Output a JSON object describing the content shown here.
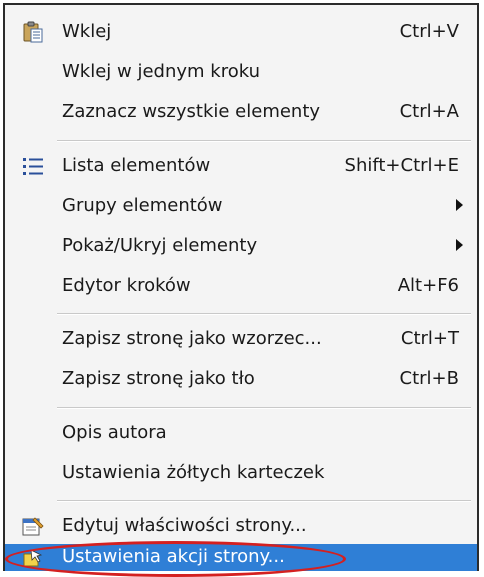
{
  "menu": {
    "items": [
      {
        "label": "Wklej",
        "shortcut": "Ctrl+V",
        "icon": "paste-icon"
      },
      {
        "label": "Wklej w jednym kroku",
        "shortcut": ""
      },
      {
        "label": "Zaznacz wszystkie elementy",
        "shortcut": "Ctrl+A"
      },
      {
        "label": "Lista elementów",
        "shortcut": "Shift+Ctrl+E",
        "icon": "list-icon"
      },
      {
        "label": "Grupy elementów",
        "submenu": true
      },
      {
        "label": "Pokaż/Ukryj elementy",
        "submenu": true
      },
      {
        "label": "Edytor kroków",
        "shortcut": "Alt+F6"
      },
      {
        "label": "Zapisz stronę jako wzorzec...",
        "shortcut": "Ctrl+T"
      },
      {
        "label": "Zapisz stronę jako tło",
        "shortcut": "Ctrl+B"
      },
      {
        "label": "Opis autora",
        "shortcut": ""
      },
      {
        "label": "Ustawienia żółtych karteczek",
        "shortcut": ""
      },
      {
        "label": "Edytuj właściwości strony...",
        "shortcut": "",
        "icon": "page-properties-icon"
      },
      {
        "label": "Ustawienia akcji strony...",
        "shortcut": "",
        "icon": "page-actions-icon",
        "highlighted": true
      }
    ]
  },
  "colors": {
    "highlight_bg": "#2f7fd6",
    "annotation_ring": "#d42020"
  }
}
